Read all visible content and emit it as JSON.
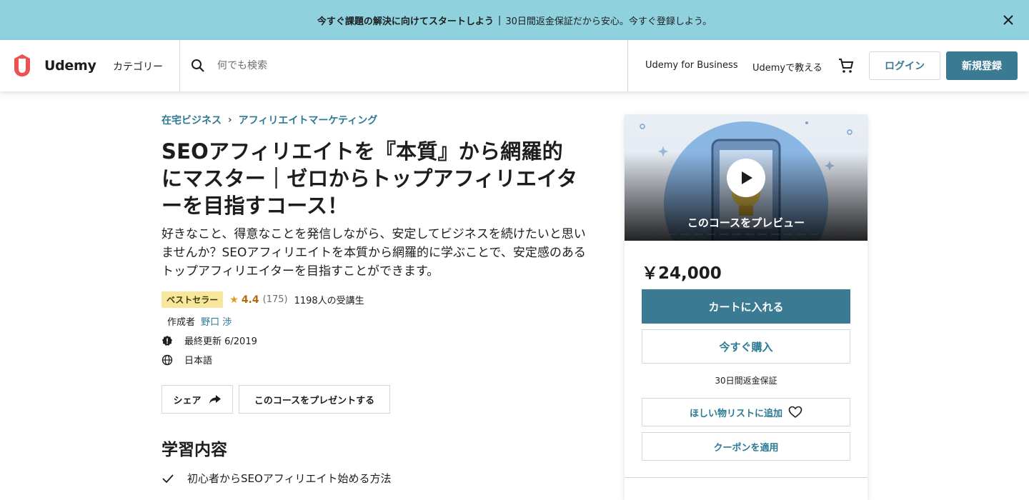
{
  "banner": {
    "bold_text": "今すぐ課題の解決に向けてスタートしよう",
    "separator": "|",
    "text": "30日間返金保証だから安心。今すぐ登録しよう。"
  },
  "header": {
    "logo_text": "Udemy",
    "categories": "カテゴリー",
    "search_placeholder": "何でも検索",
    "business_link": "Udemy for Business",
    "teach_link": "Udemyで教える",
    "login": "ログイン",
    "signup": "新規登録"
  },
  "breadcrumb": [
    "在宅ビジネス",
    "アフィリエイトマーケティング"
  ],
  "course": {
    "title": "SEOアフィリエイトを『本質』から網羅的にマスター｜ゼロからトップアフィリエイターを目指すコース！",
    "subtitle": "好きなこと、得意なことを発信しながら、安定してビジネスを続けたいと思いませんか？SEOアフィリエイトを本質から網羅的に学ぶことで、安定感のあるトップアフィリエイターを目指すことができます。",
    "badge": "ベストセラー",
    "rating": "4.4",
    "rating_count": "(175)",
    "students": "1198人の受講生",
    "author_label": "作成者",
    "author_name": "野口 渉",
    "last_updated": "最終更新 6/2019",
    "language": "日本語",
    "share": "シェア",
    "gift": "このコースをプレゼントする",
    "learn_title": "学習内容",
    "learn_items": [
      "初心者からSEOアフィリエイト始める方法"
    ]
  },
  "sidebar": {
    "preview_label": "このコースをプレビュー",
    "price": "￥24,000",
    "add_to_cart": "カートに入れる",
    "buy_now": "今すぐ購入",
    "guarantee": "30日間返金保証",
    "wishlist": "ほしい物リストに追加",
    "coupon": "クーポンを適用"
  },
  "colors": {
    "banner_bg": "#8fd1dd",
    "primary": "#3a7b93",
    "link": "#2b7a93",
    "logo": "#ec5252",
    "badge_bg": "#f8e69c",
    "star": "#e59819"
  }
}
